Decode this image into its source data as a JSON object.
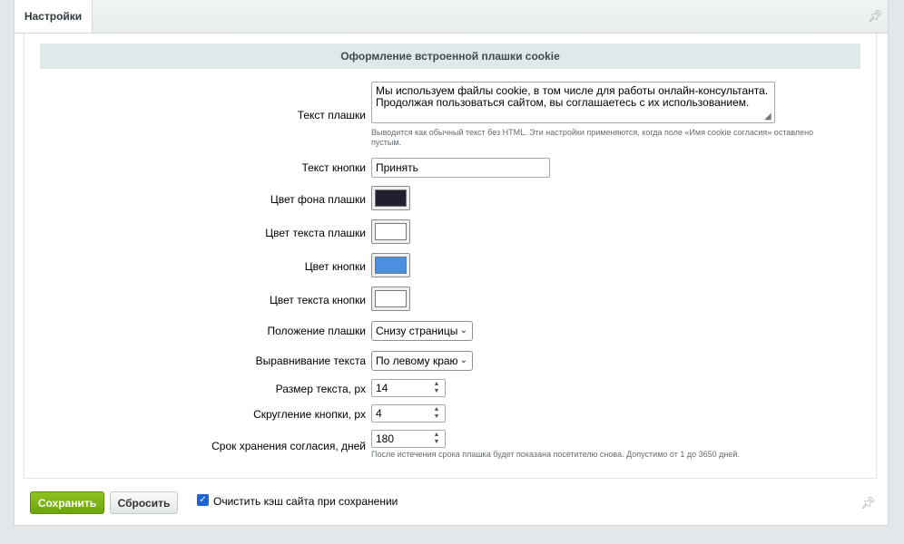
{
  "tabs": [
    {
      "label": "Настройки"
    }
  ],
  "section": {
    "title": "Оформление встроенной плашки cookie"
  },
  "fields": {
    "banner_text": {
      "label": "Текст плашки",
      "value": "Мы используем файлы cookie, в том числе для работы онлайн-консультанта.\nПродолжая пользоваться сайтом, вы соглашаетесь с их использованием.",
      "hint": "Выводится как обычный текст без HTML. Эти настройки применяются, когда поле «Имя cookie согласия» оставлено пустым."
    },
    "button_text": {
      "label": "Текст кнопки",
      "value": "Принять"
    },
    "banner_bg_color": {
      "label": "Цвет фона плашки",
      "color": "#202030"
    },
    "banner_text_color": {
      "label": "Цвет текста плашки",
      "color": "#ffffff"
    },
    "button_color": {
      "label": "Цвет кнопки",
      "color": "#4a8fe0"
    },
    "button_text_color": {
      "label": "Цвет текста кнопки",
      "color": "#ffffff"
    },
    "banner_position": {
      "label": "Положение плашки",
      "value": "Снизу страницы"
    },
    "text_align": {
      "label": "Выравнивание текста",
      "value": "По левому краю"
    },
    "font_size": {
      "label": "Размер текста, px",
      "value": "14"
    },
    "button_radius": {
      "label": "Скругление кнопки, px",
      "value": "4"
    },
    "consent_days": {
      "label": "Срок хранения согласия, дней",
      "value": "180",
      "hint": "После истечения срока плашка будет показана посетителю снова. Допустимо от 1 до 3650 дней."
    }
  },
  "footer": {
    "save_label": "Сохранить",
    "reset_label": "Сбросить",
    "clear_cache": {
      "label": "Очистить кэш сайта при сохранении",
      "checked": true
    }
  },
  "colors": {
    "accent": "#7ab317",
    "page_bg": "#e3e7ea"
  },
  "icons": {
    "pin": "pin-icon",
    "chevron": "chevron-down-icon",
    "spinner": "spinner-arrows-icon"
  }
}
